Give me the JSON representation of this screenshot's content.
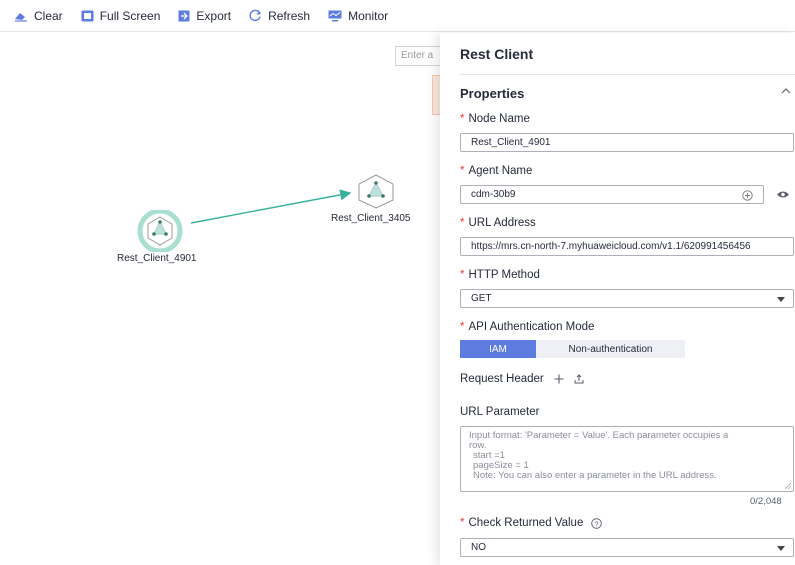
{
  "toolbar": {
    "items": [
      {
        "label": "Clear",
        "icon": "eraser-icon"
      },
      {
        "label": "Full Screen",
        "icon": "fullscreen-icon"
      },
      {
        "label": "Export",
        "icon": "export-icon"
      },
      {
        "label": "Refresh",
        "icon": "refresh-icon"
      },
      {
        "label": "Monitor",
        "icon": "monitor-icon"
      }
    ]
  },
  "canvas": {
    "search_placeholder": "Enter a",
    "nodes": [
      {
        "label": "Rest_Client_4901"
      },
      {
        "label": "Rest_Client_3405"
      }
    ]
  },
  "panel": {
    "title": "Rest Client",
    "section_title": "Properties",
    "node_name": {
      "label": "Node Name",
      "value": "Rest_Client_4901"
    },
    "agent_name": {
      "label": "Agent Name",
      "value": "cdm-30b9"
    },
    "url_address": {
      "label": "URL Address",
      "value": "https://mrs.cn-north-7.myhuaweicloud.com/v1.1/620991456456"
    },
    "http_method": {
      "label": "HTTP Method",
      "value": "GET"
    },
    "auth_mode": {
      "label": "API Authentication Mode",
      "options": [
        "IAM",
        "Non-authentication"
      ],
      "selected": "IAM"
    },
    "request_header": {
      "label": "Request Header"
    },
    "url_parameter": {
      "label": "URL Parameter",
      "placeholder_lines": [
        "Input format: 'Parameter = Value'. Each parameter occupies a",
        "row.",
        "start =1",
        "pageSize = 1",
        "Note: You can also enter a parameter in the URL address."
      ],
      "counter": "0/2,048"
    },
    "check_returned": {
      "label": "Check Returned Value",
      "value": "NO"
    }
  },
  "colors": {
    "accent": "#5e7ce0",
    "required": "#e5373b",
    "edge": "#3ab09e",
    "node_ring": "#a8dfd0"
  }
}
